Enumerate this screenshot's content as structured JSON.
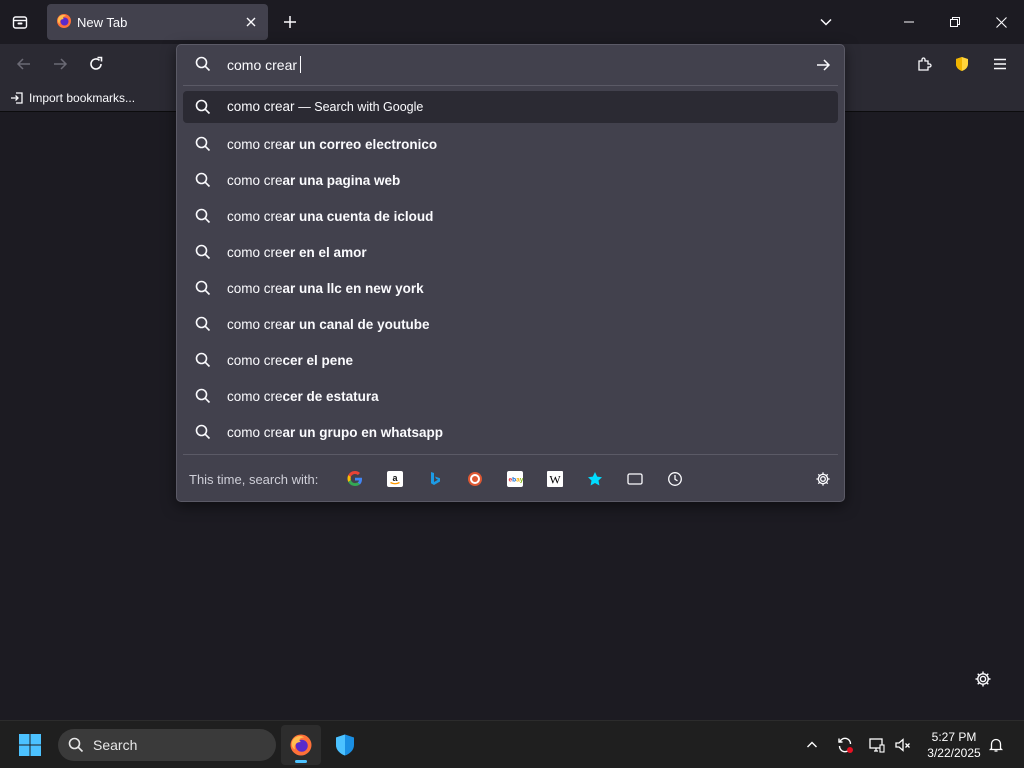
{
  "tabstrip": {
    "tab_title": "New Tab"
  },
  "bookmarks": {
    "import_label": "Import bookmarks..."
  },
  "urlbar": {
    "input_value": "como crear",
    "heuristic": {
      "query": "como crear",
      "action": "— Search with Google"
    },
    "suggestions": [
      {
        "typed": "como cre",
        "completion": "ar un correo electronico"
      },
      {
        "typed": "como cre",
        "completion": "ar una pagina web"
      },
      {
        "typed": "como cre",
        "completion": "ar una cuenta de icloud"
      },
      {
        "typed": "como cre",
        "completion": "er en el amor"
      },
      {
        "typed": "como cre",
        "completion": "ar una llc en new york"
      },
      {
        "typed": "como cre",
        "completion": "ar un canal de youtube"
      },
      {
        "typed": "como cre",
        "completion": "cer el pene"
      },
      {
        "typed": "como cre",
        "completion": "cer de estatura"
      },
      {
        "typed": "como cre",
        "completion": "ar un grupo en whatsapp"
      }
    ],
    "oneoff_label": "This time, search with:",
    "engines": [
      "google-icon",
      "amazon-icon",
      "bing-icon",
      "duckduckgo-icon",
      "ebay-icon",
      "wikipedia-icon",
      "bookmarks-star-icon",
      "tabs-icon",
      "history-icon"
    ]
  },
  "taskbar": {
    "search_label": "Search",
    "time": "5:27 PM",
    "date": "3/22/2025"
  },
  "colors": {
    "accent": "#4cc2ff",
    "popup_bg": "#42414d",
    "toolbar_bg": "#2b2a33",
    "page_bg": "#1c1b22"
  }
}
